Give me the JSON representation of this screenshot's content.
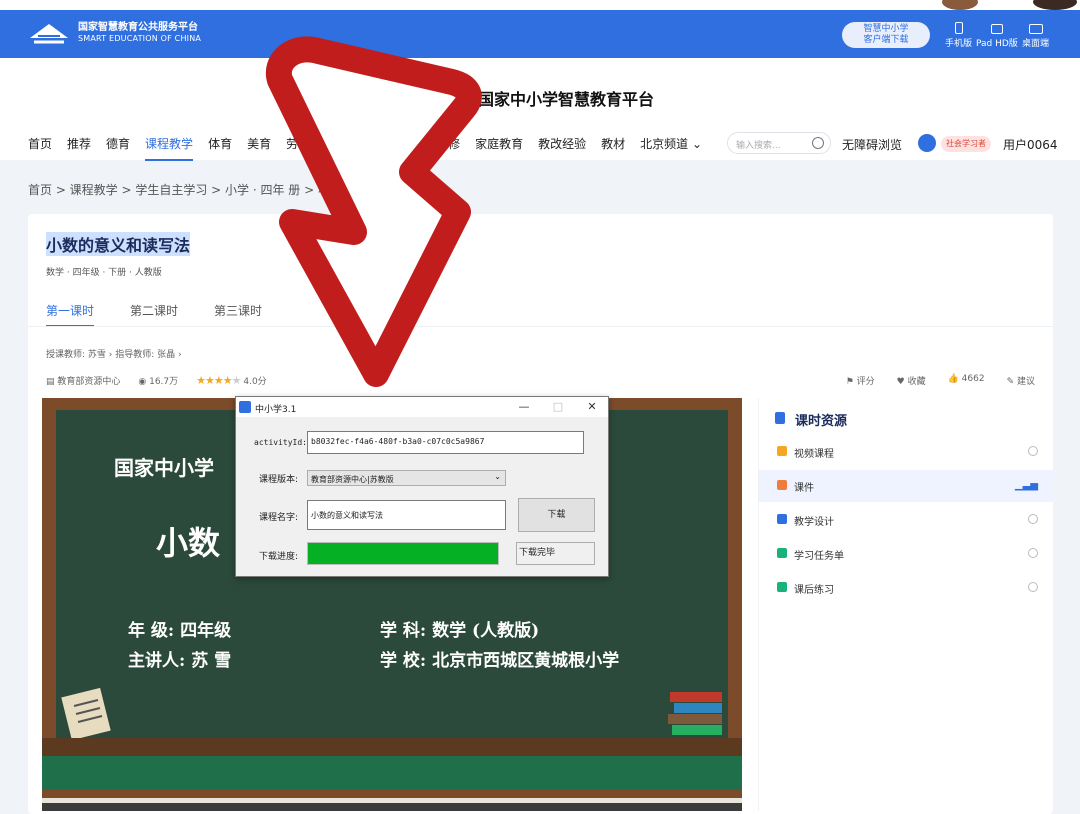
{
  "colors": {
    "brand": "#2f6fdf",
    "annotation_arrow": "#c11d1d",
    "progress": "#06b025"
  },
  "topbar": {
    "logo_cn": "国家智慧教育公共服务平台",
    "logo_en": "SMART EDUCATION OF CHINA",
    "client_download": [
      "智慧中小学",
      "客户端下载"
    ],
    "devices": [
      "手机版",
      "Pad HD版",
      "桌面端"
    ]
  },
  "header": {
    "site_title": "国家中小学智慧教育平台",
    "nav": [
      "首页",
      "推荐",
      "德育",
      "课程教学",
      "体育",
      "美育",
      "劳",
      "修",
      "家庭教育",
      "教改经验",
      "教材",
      "北京频道 ⌄"
    ],
    "nav_active": "课程教学",
    "search_placeholder": "输入搜索...",
    "accessibility": "无障碍浏览",
    "user_badge": "社会学习者",
    "user_name": "用户0064"
  },
  "breadcrumb": "首页 > 课程教学 > 学生自主学习 > 小学 · 四年                 册 > 小数的意义和读写法",
  "course": {
    "title": "小数的意义和读写法",
    "subtitle": "数学 · 四年级 · 下册 · 人教版",
    "tabs": [
      "第一课时",
      "第二课时",
      "第三课时"
    ],
    "teachers": "授课教师:  苏雪 ›      指导教师:  张晶 ›",
    "source": "教育部资源中心",
    "views": "16.7万",
    "rating_text": "4.0分",
    "rating": 4,
    "actions": [
      "评分",
      "收藏",
      "4662",
      "建议"
    ]
  },
  "board": {
    "platform": "国家中小学",
    "lesson": "小数",
    "line1_left": "年  级: 四年级",
    "line1_right": "学  科: 数学 (人教版)",
    "line2_left": "主讲人: 苏  雪",
    "line2_right": "学  校: 北京市西城区黄城根小学"
  },
  "resources": {
    "heading": "课时资源",
    "items": [
      {
        "label": "视频课程",
        "icon": "video-icon",
        "color": "#f5a623",
        "selected": false
      },
      {
        "label": "课件",
        "icon": "slides-icon",
        "color": "#f07b3f",
        "selected": true
      },
      {
        "label": "教学设计",
        "icon": "design-icon",
        "color": "#2f6fdf",
        "selected": false
      },
      {
        "label": "学习任务单",
        "icon": "task-icon",
        "color": "#19b37a",
        "selected": false
      },
      {
        "label": "课后练习",
        "icon": "exercise-icon",
        "color": "#19b37a",
        "selected": false
      }
    ]
  },
  "dialog": {
    "title": "中小学3.1",
    "activity_label": "activityId:",
    "activity_value": "b8032fec-f4a6-480f-b3a0-c07c0c5a9867",
    "version_label": "课程版本:",
    "version_value": "教育部资源中心|苏教版",
    "name_label": "课程名字:",
    "name_value": "小数的意义和读写法",
    "download_label": "下载",
    "progress_label": "下载进度:",
    "progress": 1.0,
    "status": "下载完毕"
  }
}
